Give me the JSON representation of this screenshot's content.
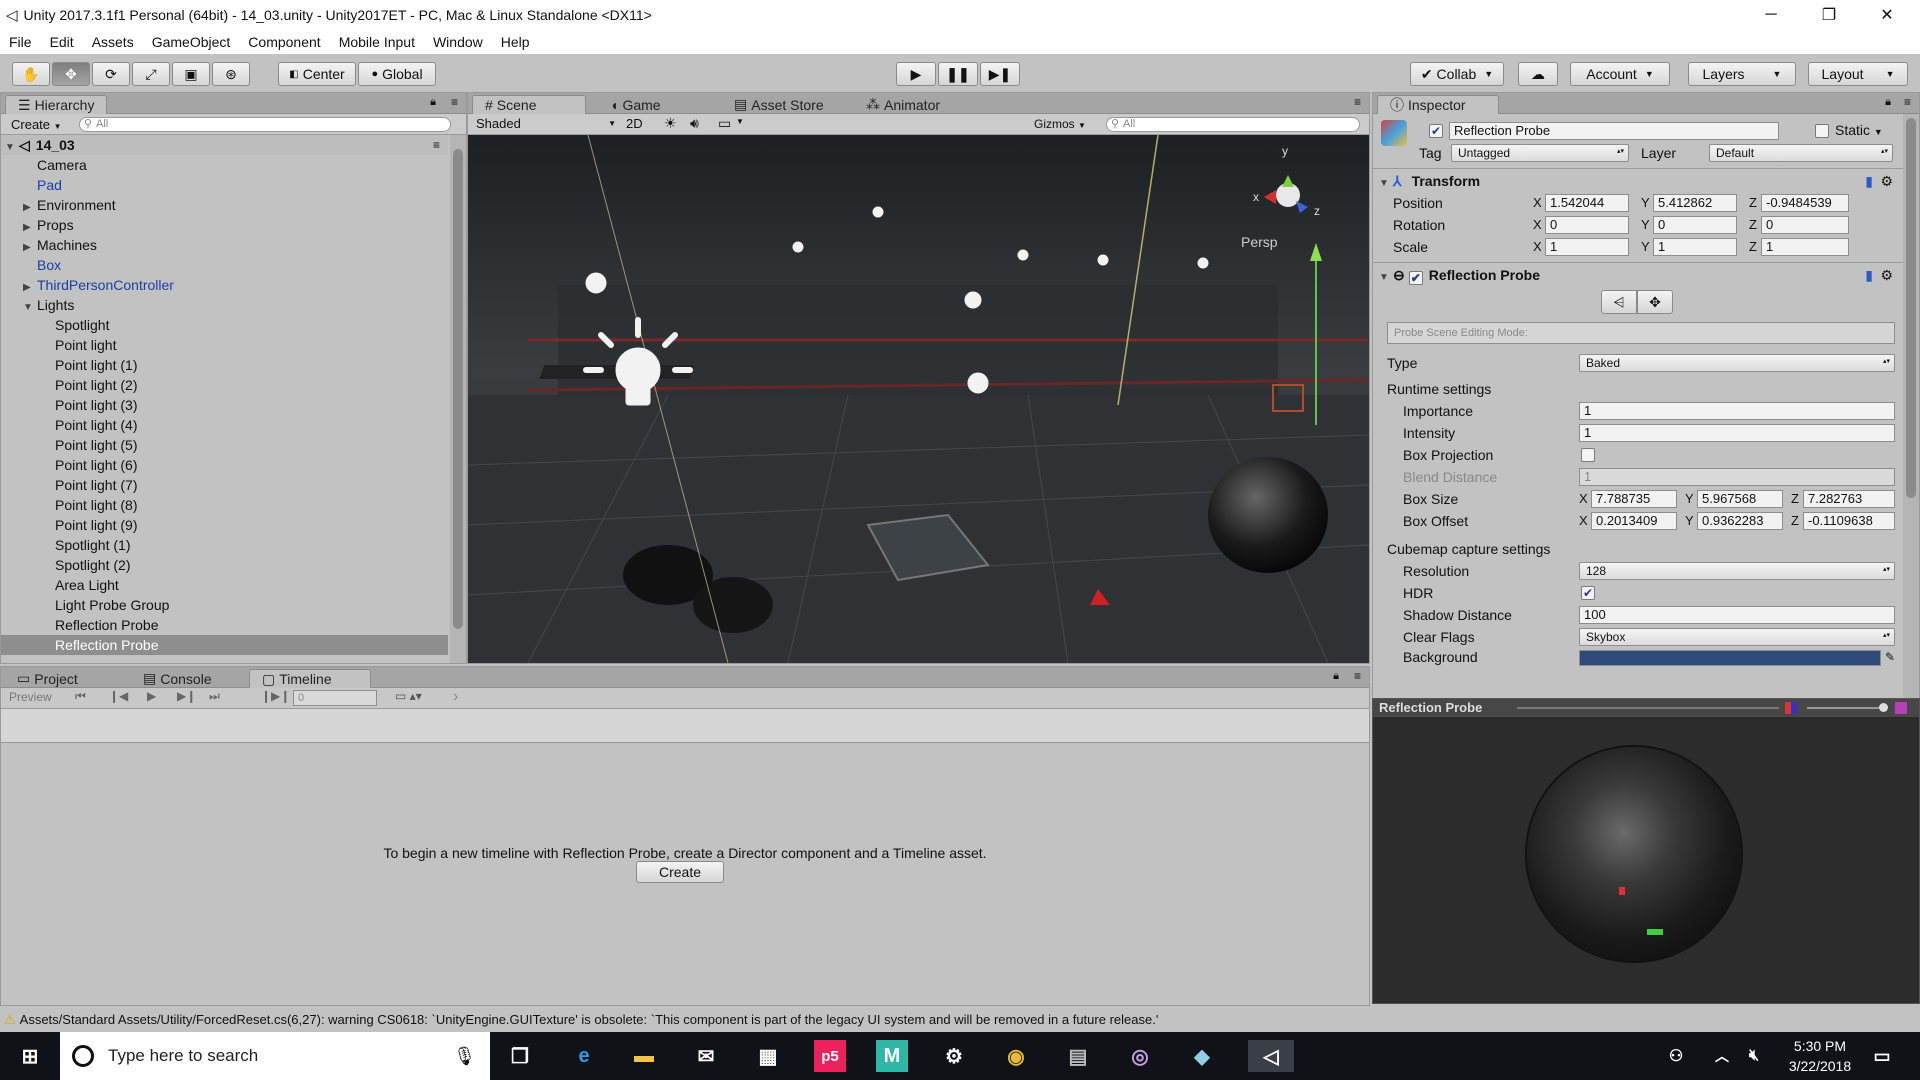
{
  "window": {
    "title": "Unity 2017.3.1f1 Personal (64bit) - 14_03.unity - Unity2017ET - PC, Mac & Linux Standalone <DX11>"
  },
  "menu": [
    "File",
    "Edit",
    "Assets",
    "GameObject",
    "Component",
    "Mobile Input",
    "Window",
    "Help"
  ],
  "toolbar": {
    "pivot_label": "Center",
    "space_label": "Global",
    "collab_label": "Collab",
    "account_label": "Account",
    "layers_label": "Layers",
    "layout_label": "Layout"
  },
  "hierarchy": {
    "tab": "Hierarchy",
    "create_label": "Create",
    "search_placeholder": "All",
    "scene_name": "14_03",
    "items": [
      {
        "label": "Camera",
        "indent": 1,
        "prefab": false,
        "expander": ""
      },
      {
        "label": "Pad",
        "indent": 1,
        "prefab": true,
        "expander": ""
      },
      {
        "label": "Environment",
        "indent": 1,
        "prefab": false,
        "expander": "▶"
      },
      {
        "label": "Props",
        "indent": 1,
        "prefab": false,
        "expander": "▶"
      },
      {
        "label": "Machines",
        "indent": 1,
        "prefab": false,
        "expander": "▶"
      },
      {
        "label": "Box",
        "indent": 1,
        "prefab": true,
        "expander": ""
      },
      {
        "label": "ThirdPersonController",
        "indent": 1,
        "prefab": true,
        "expander": "▶"
      },
      {
        "label": "Lights",
        "indent": 1,
        "prefab": false,
        "expander": "▼"
      },
      {
        "label": "Spotlight",
        "indent": 2,
        "prefab": false,
        "expander": ""
      },
      {
        "label": "Point light",
        "indent": 2,
        "prefab": false,
        "expander": ""
      },
      {
        "label": "Point light (1)",
        "indent": 2,
        "prefab": false,
        "expander": ""
      },
      {
        "label": "Point light (2)",
        "indent": 2,
        "prefab": false,
        "expander": ""
      },
      {
        "label": "Point light (3)",
        "indent": 2,
        "prefab": false,
        "expander": ""
      },
      {
        "label": "Point light (4)",
        "indent": 2,
        "prefab": false,
        "expander": ""
      },
      {
        "label": "Point light (5)",
        "indent": 2,
        "prefab": false,
        "expander": ""
      },
      {
        "label": "Point light (6)",
        "indent": 2,
        "prefab": false,
        "expander": ""
      },
      {
        "label": "Point light (7)",
        "indent": 2,
        "prefab": false,
        "expander": ""
      },
      {
        "label": "Point light (8)",
        "indent": 2,
        "prefab": false,
        "expander": ""
      },
      {
        "label": "Point light (9)",
        "indent": 2,
        "prefab": false,
        "expander": ""
      },
      {
        "label": "Spotlight (1)",
        "indent": 2,
        "prefab": false,
        "expander": ""
      },
      {
        "label": "Spotlight (2)",
        "indent": 2,
        "prefab": false,
        "expander": ""
      },
      {
        "label": "Area Light",
        "indent": 2,
        "prefab": false,
        "expander": ""
      },
      {
        "label": "Light Probe Group",
        "indent": 2,
        "prefab": false,
        "expander": ""
      },
      {
        "label": "Reflection Probe",
        "indent": 2,
        "prefab": false,
        "expander": ""
      },
      {
        "label": "Reflection Probe",
        "indent": 2,
        "prefab": false,
        "expander": "",
        "selected": true
      }
    ]
  },
  "scene": {
    "tabs": [
      "Scene",
      "Game",
      "Asset Store",
      "Animator"
    ],
    "shading": "Shaded",
    "mode_2d": "2D",
    "gizmos_label": "Gizmos",
    "search_placeholder": "All",
    "persp_label": "Persp",
    "axis_x": "x",
    "axis_y": "y",
    "axis_z": "z"
  },
  "bottom": {
    "tabs": [
      "Project",
      "Console",
      "Timeline"
    ],
    "preview_label": "Preview",
    "frame_value": "0",
    "message": "To begin a new timeline with Reflection Probe, create a Director component and a Timeline asset.",
    "create_button": "Create"
  },
  "inspector": {
    "tab": "Inspector",
    "object_name": "Reflection Probe",
    "static_label": "Static",
    "tag_label": "Tag",
    "tag_value": "Untagged",
    "layer_label": "Layer",
    "layer_value": "Default",
    "transform": {
      "title": "Transform",
      "position_label": "Position",
      "position": [
        "1.542044",
        "5.412862",
        "-0.9484539"
      ],
      "rotation_label": "Rotation",
      "rotation": [
        "0",
        "0",
        "0"
      ],
      "scale_label": "Scale",
      "scale": [
        "1",
        "1",
        "1"
      ]
    },
    "probe": {
      "title": "Reflection Probe",
      "editing_mode_placeholder": "Probe Scene Editing Mode:",
      "type_label": "Type",
      "type_value": "Baked",
      "runtime_label": "Runtime settings",
      "importance_label": "Importance",
      "importance": "1",
      "intensity_label": "Intensity",
      "intensity": "1",
      "box_projection_label": "Box Projection",
      "blend_distance_label": "Blend Distance",
      "blend_distance": "1",
      "box_size_label": "Box Size",
      "box_size": [
        "7.788735",
        "5.967568",
        "7.282763"
      ],
      "box_offset_label": "Box Offset",
      "box_offset": [
        "0.2013409",
        "0.9362283",
        "-0.1109638"
      ],
      "cubemap_label": "Cubemap capture settings",
      "resolution_label": "Resolution",
      "resolution": "128",
      "hdr_label": "HDR",
      "shadow_distance_label": "Shadow Distance",
      "shadow_distance": "100",
      "clear_flags_label": "Clear Flags",
      "clear_flags": "Skybox",
      "background_label": "Background"
    },
    "preview_title": "Reflection Probe"
  },
  "status": {
    "warning": "Assets/Standard Assets/Utility/ForcedReset.cs(6,27): warning CS0618: `UnityEngine.GUITexture' is obsolete: `This component is part of the legacy UI system and will be removed in a future release.'"
  },
  "taskbar": {
    "search_placeholder": "Type here to search",
    "time": "5:30 PM",
    "date": "3/22/2018"
  },
  "colors": {
    "accent": "#1a3ea8",
    "scene_bg": "#2a2d30",
    "taskbar": "#0f1217"
  }
}
